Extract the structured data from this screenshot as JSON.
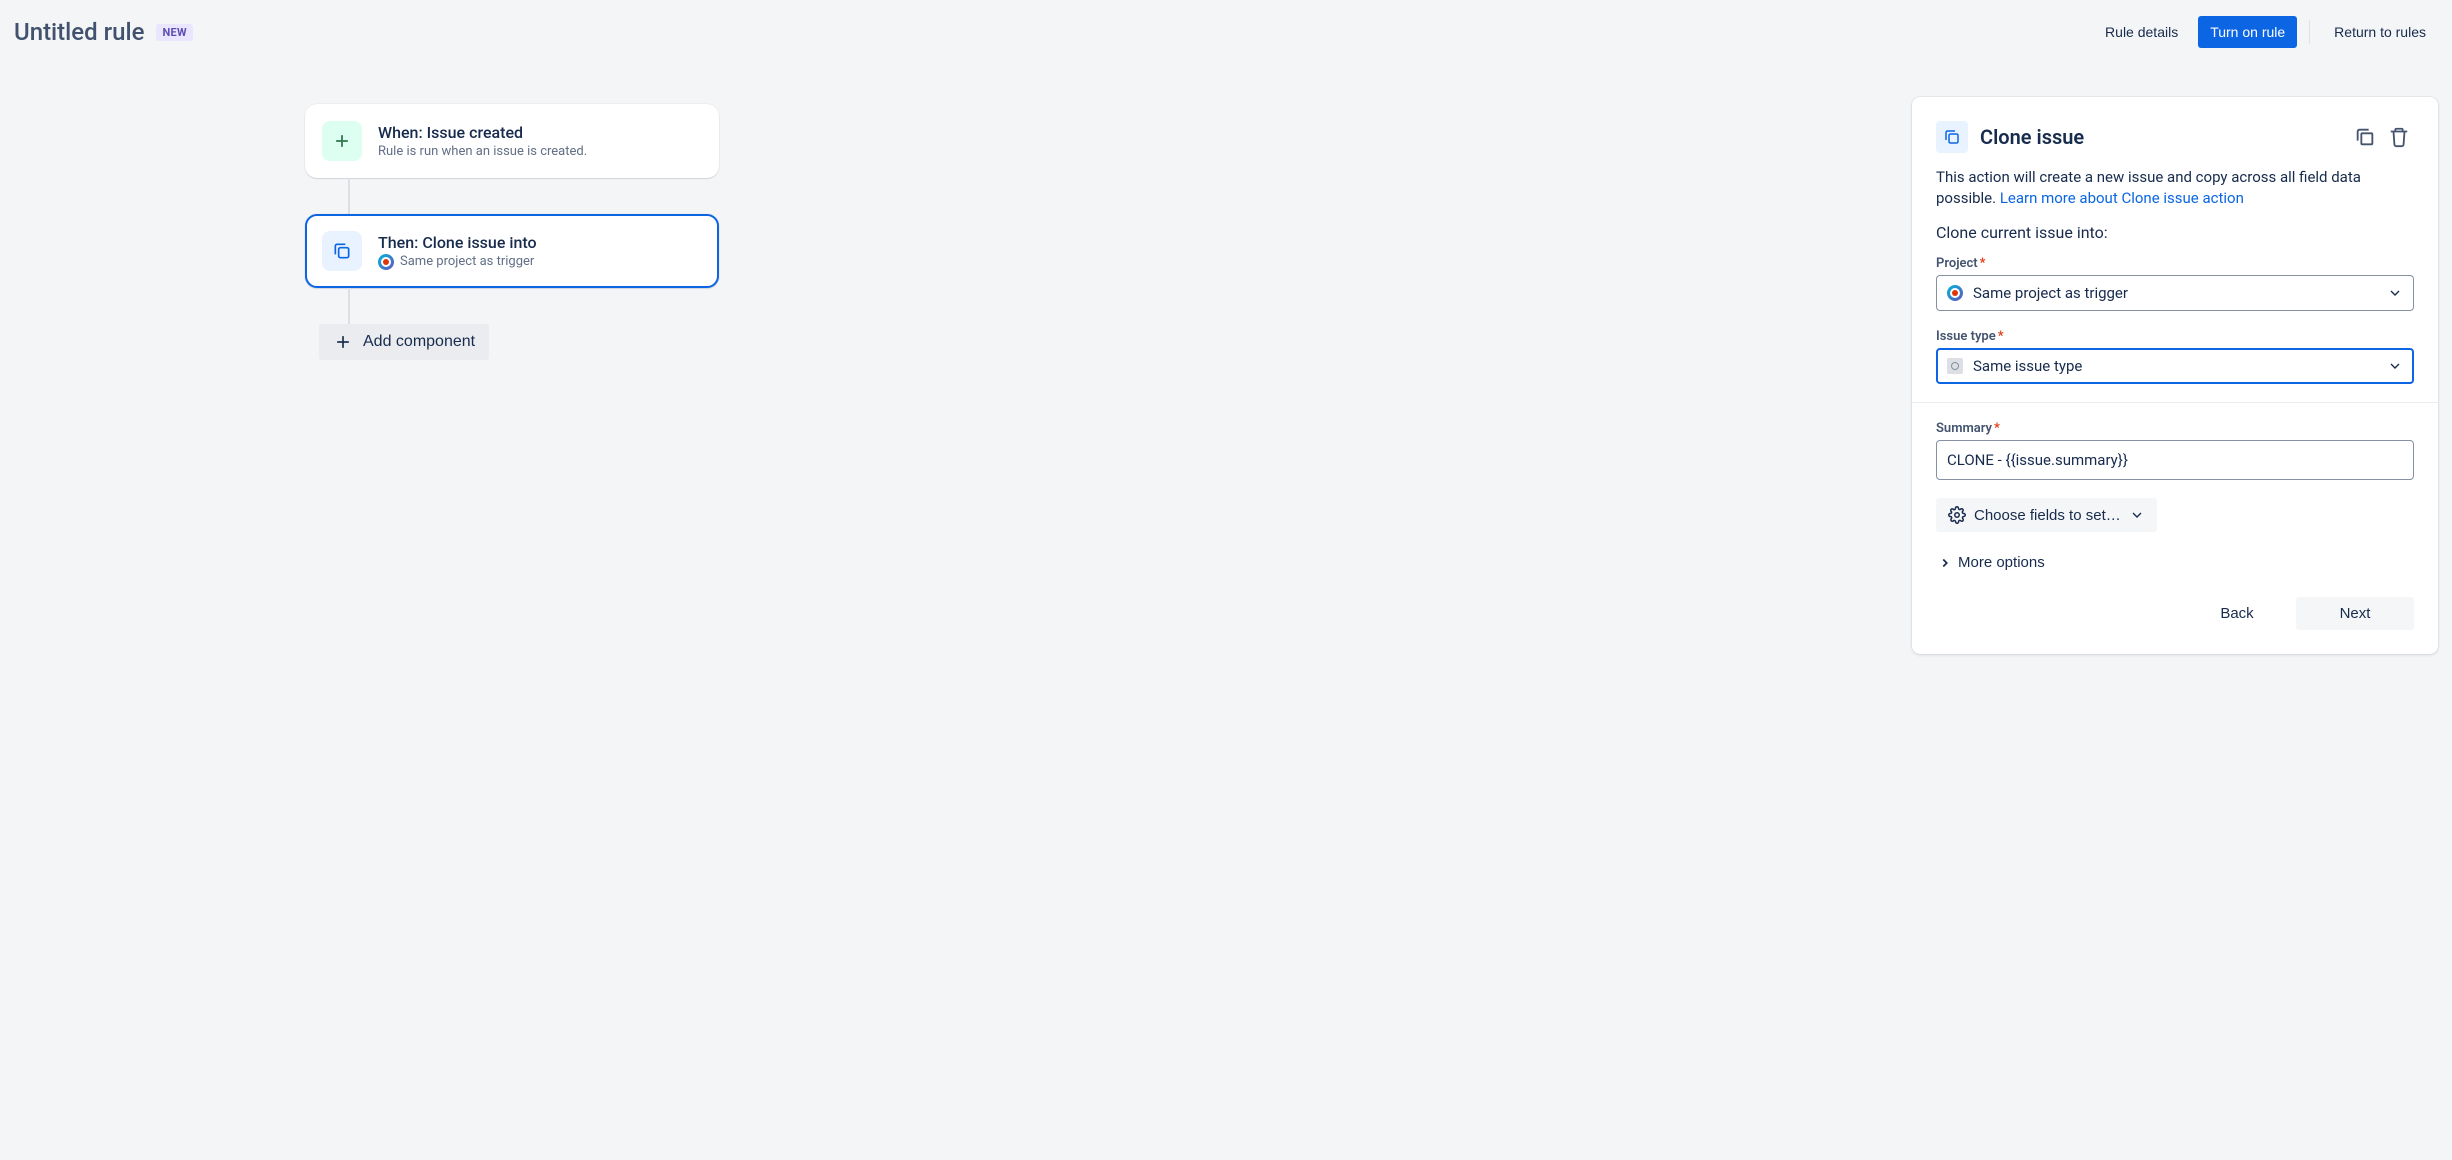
{
  "header": {
    "title": "Untitled rule",
    "badge": "NEW",
    "rule_details": "Rule details",
    "turn_on": "Turn on rule",
    "return": "Return to rules"
  },
  "canvas": {
    "trigger": {
      "title": "When: Issue created",
      "sub": "Rule is run when an issue is created."
    },
    "action": {
      "title": "Then: Clone issue into",
      "sub": "Same project as trigger"
    },
    "add_component": "Add component"
  },
  "panel": {
    "title": "Clone issue",
    "desc": "This action will create a new issue and copy across all field data possible. ",
    "learn_more": "Learn more about Clone issue action",
    "subheading": "Clone current issue into:",
    "project": {
      "label": "Project",
      "value": "Same project as trigger"
    },
    "issue_type": {
      "label": "Issue type",
      "value": "Same issue type"
    },
    "summary": {
      "label": "Summary",
      "value": "CLONE - {{issue.summary}}"
    },
    "choose_fields": "Choose fields to set…",
    "more_options": "More options",
    "back": "Back",
    "next": "Next"
  }
}
